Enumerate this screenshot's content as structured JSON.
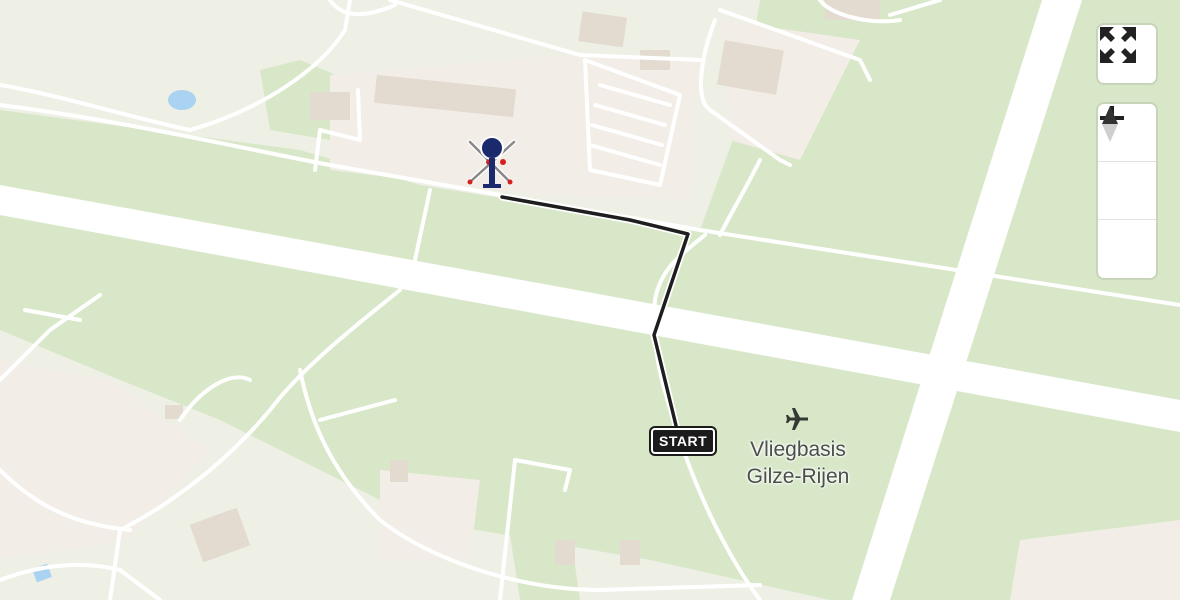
{
  "map": {
    "airport_name_line1": "Vliegbasis",
    "airport_name_line2": "Gilze-Rijen",
    "route_start_label": "START",
    "airport_icon": "airplane-icon",
    "destination_icon": "helicopter-icon",
    "colors": {
      "grass": "#d8e7c8",
      "background": "#eef0e6",
      "runway": "#ffffff",
      "route": "#1e1e1e",
      "building": "#e4ddd4",
      "water": "#a9d3f0",
      "helicopter_body": "#1a2a6c"
    }
  },
  "controls": {
    "fullscreen_icon": "fullscreen-icon",
    "zoom_in_icon": "zoom-in-icon",
    "zoom_out_icon": "zoom-out-icon",
    "compass_icon": "compass-icon"
  }
}
